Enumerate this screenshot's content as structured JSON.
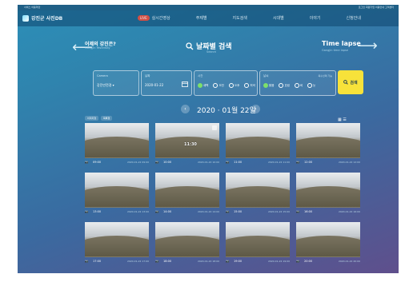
{
  "topbar": {
    "left": "서비스  이용약관",
    "right": "로그인  회원가입  이용안내  고객센터"
  },
  "nav": {
    "logo": "강진군 사진DB",
    "live_badge": "LIVE",
    "live_label": "실시간영상",
    "items": [
      "주제별",
      "지도검색",
      "시대별",
      "이야기",
      "신청안내"
    ]
  },
  "hero": {
    "prev_title": "어제의 강진은?",
    "prev_sub": "Gangjin Yesterday",
    "center_title": "날짜별 검색",
    "center_sub": "Search",
    "next_title": "Time lapse",
    "next_sub": "Gangjin time lapse"
  },
  "filters": {
    "camera": {
      "label": "Camera",
      "value": "강진만전경 ▾"
    },
    "date": {
      "label": "날짜",
      "value": "2020-01-22"
    },
    "time": {
      "label": "시간",
      "options": [
        "새벽",
        "오전",
        "오후",
        "저녁"
      ]
    },
    "weather": {
      "label": "날씨",
      "hint": "복수선택 가능",
      "options": [
        "맑음",
        "흐림",
        "비",
        "눈"
      ]
    },
    "search_label": "검색"
  },
  "date_nav": {
    "date": "2020 ⋅ 01월 22일"
  },
  "tags": [
    "이미지형",
    "목록형"
  ],
  "view_icons": "▦ ☰",
  "cards": [
    {
      "cam": "📷",
      "caption": "09:00",
      "stamp": "2020-01-22 09:00"
    },
    {
      "cam": "📷",
      "caption": "10:00",
      "stamp": "2020-01-22 10:00",
      "time": "11:30"
    },
    {
      "cam": "📷",
      "caption": "11:00",
      "stamp": "2020-01-22 11:00"
    },
    {
      "cam": "📷",
      "caption": "12:00",
      "stamp": "2020-01-22 12:00"
    },
    {
      "cam": "📷",
      "caption": "13:00",
      "stamp": "2020-01-22 13:00"
    },
    {
      "cam": "📷",
      "caption": "14:00",
      "stamp": "2020-01-22 14:00"
    },
    {
      "cam": "📷",
      "caption": "15:00",
      "stamp": "2020-01-22 15:00"
    },
    {
      "cam": "📷",
      "caption": "16:00",
      "stamp": "2020-01-22 16:00"
    },
    {
      "cam": "📷",
      "caption": "17:00",
      "stamp": "2020-01-22 17:00"
    },
    {
      "cam": "📷",
      "caption": "18:00",
      "stamp": "2020-01-22 18:00"
    },
    {
      "cam": "📷",
      "caption": "19:00",
      "stamp": "2020-01-22 19:00"
    },
    {
      "cam": "📷",
      "caption": "20:00",
      "stamp": "2020-01-22 20:00"
    }
  ],
  "colors": {
    "accent": "#f7e23a",
    "bg_top": "#2c8fb8",
    "bg_bottom": "#5f4f8c"
  }
}
